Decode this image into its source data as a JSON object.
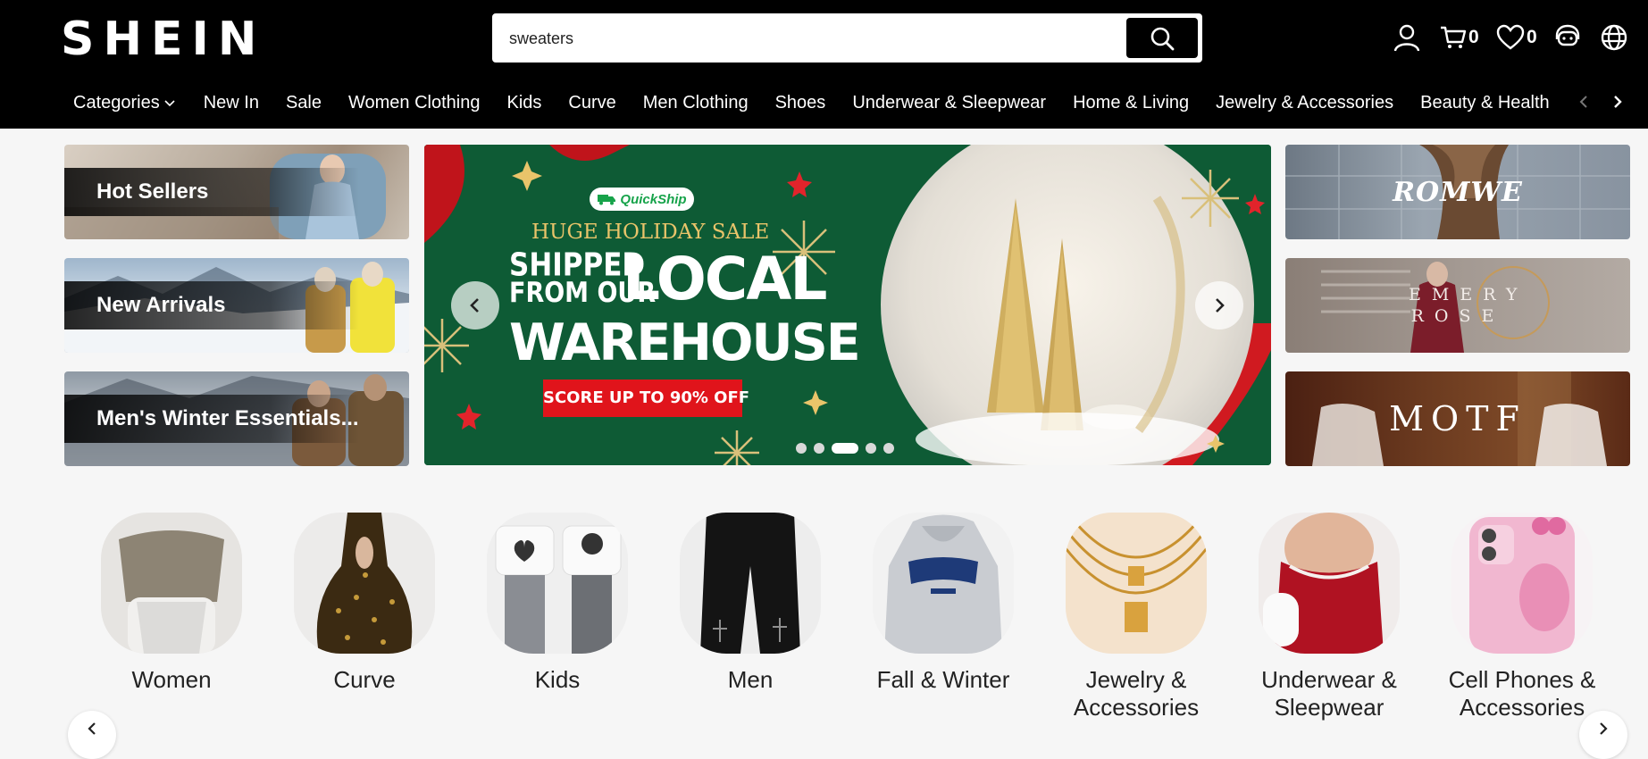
{
  "header": {
    "logo": "SHEIN",
    "search": {
      "value": "sweaters"
    },
    "cart_count": "0",
    "wishlist_count": "0"
  },
  "nav": {
    "items": [
      "Categories",
      "New In",
      "Sale",
      "Women Clothing",
      "Kids",
      "Curve",
      "Men Clothing",
      "Shoes",
      "Underwear & Sleepwear",
      "Home & Living",
      "Jewelry & Accessories",
      "Beauty & Health"
    ]
  },
  "left_cards": [
    "Hot Sellers",
    "New Arrivals",
    "Men's Winter Essentials..."
  ],
  "banner": {
    "badge": "QuickShip",
    "headline": "HUGE HOLIDAY SALE",
    "line1": "SHIPPED",
    "line2": "FROM OUR",
    "big1": "LOCAL",
    "big2": "WAREHOUSE",
    "cta": "SCORE UP TO 90% OFF",
    "active_dot": 3,
    "dot_count": 5
  },
  "brands": [
    "ROMWE",
    "EMERY ROSE",
    "MOTF"
  ],
  "categories": [
    "Women",
    "Curve",
    "Kids",
    "Men",
    "Fall & Winter",
    "Jewelry & Accessories",
    "Underwear & Sleepwear",
    "Cell Phones & Accessories"
  ],
  "colors": {
    "header_bg": "#000000",
    "banner_green": "#0d5a34",
    "cta_red": "#e0141b",
    "gold": "#e9c46a"
  }
}
